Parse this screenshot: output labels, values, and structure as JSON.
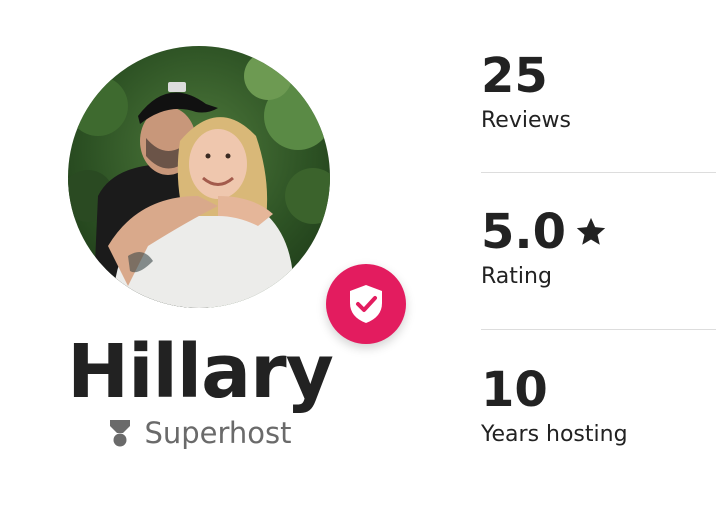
{
  "host": {
    "name": "Hillary",
    "superhost_label": "Superhost",
    "photo_alt": "Host profile photo",
    "verified": true
  },
  "stats": [
    {
      "value": "25",
      "label": "Reviews",
      "icon": null
    },
    {
      "value": "5.0",
      "label": "Rating",
      "icon": "star-icon"
    },
    {
      "value": "10",
      "label": "Years hosting",
      "icon": null
    }
  ],
  "colors": {
    "accent": "#e31c5f",
    "text": "#222222",
    "muted": "#6a6a6a",
    "divider": "#dddddd"
  }
}
